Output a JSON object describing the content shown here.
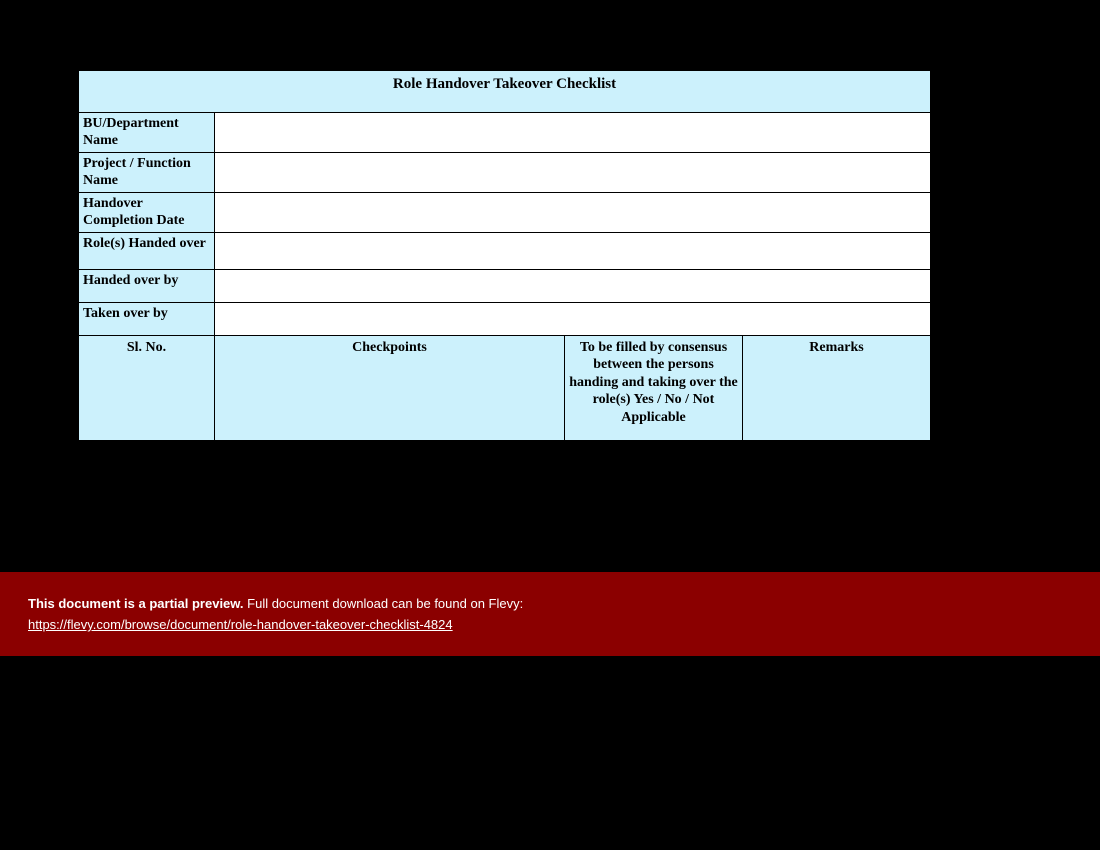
{
  "title": "Role Handover Takeover Checklist",
  "info_rows": [
    {
      "label": "BU/Department Name",
      "value": ""
    },
    {
      "label": "Project / Function Name",
      "value": ""
    },
    {
      "label": "Handover Completion Date",
      "value": ""
    },
    {
      "label": "Role(s) Handed over",
      "value": ""
    },
    {
      "label": "Handed over by",
      "value": ""
    },
    {
      "label": "Taken over by",
      "value": ""
    }
  ],
  "columns": {
    "c1": "Sl. No.",
    "c2": "Checkpoints",
    "c3": "To be filled by consensus between the persons handing and taking over the role(s) Yes / No / Not Applicable",
    "c4": "Remarks"
  },
  "banner": {
    "bold": "This document is a partial preview.",
    "rest": " Full document download can be found on Flevy:",
    "url": "https://flevy.com/browse/document/role-handover-takeover-checklist-4824"
  }
}
